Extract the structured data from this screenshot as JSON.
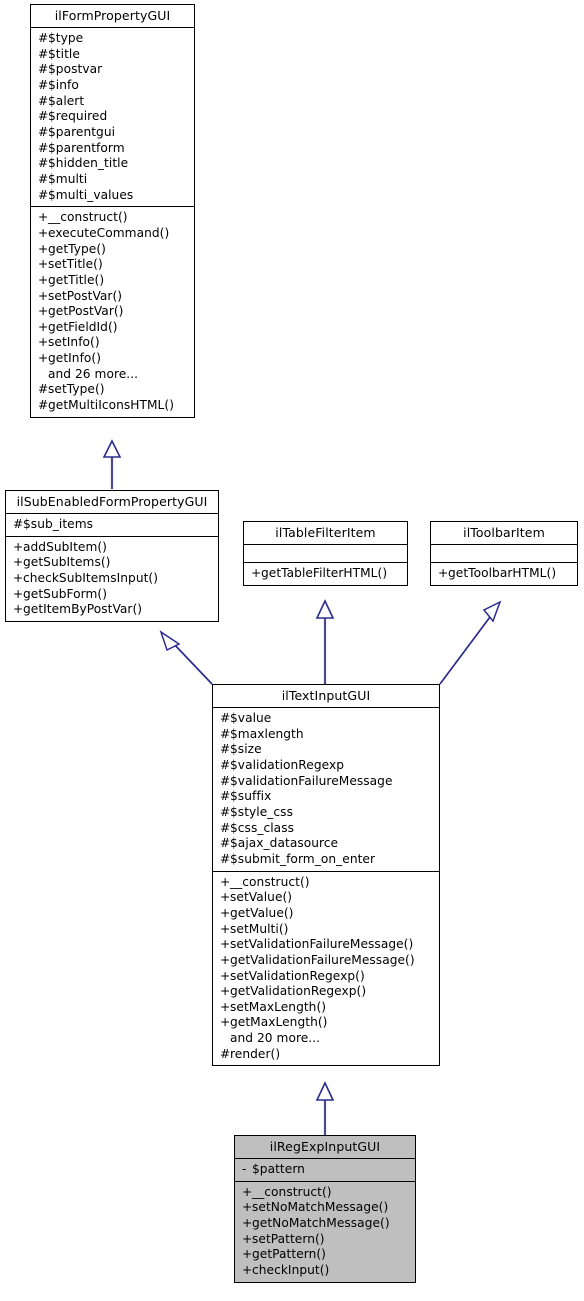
{
  "diagram": {
    "type": "uml-class-inheritance-diagram",
    "edge_color": "#2b2b8f",
    "highlight_fill": "#bfbfbf",
    "background": "#ffffff",
    "relationship": "generalization"
  },
  "classes": [
    {
      "id": "ilFormPropertyGUI",
      "name": "ilFormPropertyGUI",
      "highlighted": false,
      "attributes": [
        {
          "vis": "#",
          "label": "$type"
        },
        {
          "vis": "#",
          "label": "$title"
        },
        {
          "vis": "#",
          "label": "$postvar"
        },
        {
          "vis": "#",
          "label": "$info"
        },
        {
          "vis": "#",
          "label": "$alert"
        },
        {
          "vis": "#",
          "label": "$required"
        },
        {
          "vis": "#",
          "label": "$parentgui"
        },
        {
          "vis": "#",
          "label": "$parentform"
        },
        {
          "vis": "#",
          "label": "$hidden_title"
        },
        {
          "vis": "#",
          "label": "$multi"
        },
        {
          "vis": "#",
          "label": "$multi_values"
        }
      ],
      "operations": [
        {
          "vis": "+",
          "label": "__construct()"
        },
        {
          "vis": "+",
          "label": "executeCommand()"
        },
        {
          "vis": "+",
          "label": "getType()"
        },
        {
          "vis": "+",
          "label": "setTitle()"
        },
        {
          "vis": "+",
          "label": "getTitle()"
        },
        {
          "vis": "+",
          "label": "setPostVar()"
        },
        {
          "vis": "+",
          "label": "getPostVar()"
        },
        {
          "vis": "+",
          "label": "getFieldId()"
        },
        {
          "vis": "+",
          "label": "setInfo()"
        },
        {
          "vis": "+",
          "label": "getInfo()"
        },
        {
          "vis": "",
          "label": "and 26 more..."
        },
        {
          "vis": "#",
          "label": "setType()"
        },
        {
          "vis": "#",
          "label": "getMultiIconsHTML()"
        }
      ]
    },
    {
      "id": "ilSubEnabledFormPropertyGUI",
      "name": "ilSubEnabledFormPropertyGUI",
      "highlighted": false,
      "attributes": [
        {
          "vis": "#",
          "label": "$sub_items"
        }
      ],
      "operations": [
        {
          "vis": "+",
          "label": "addSubItem()"
        },
        {
          "vis": "+",
          "label": "getSubItems()"
        },
        {
          "vis": "+",
          "label": "checkSubItemsInput()"
        },
        {
          "vis": "+",
          "label": "getSubForm()"
        },
        {
          "vis": "+",
          "label": "getItemByPostVar()"
        }
      ]
    },
    {
      "id": "ilTableFilterItem",
      "name": "ilTableFilterItem",
      "highlighted": false,
      "attributes": [],
      "operations": [
        {
          "vis": "+",
          "label": "getTableFilterHTML()"
        }
      ]
    },
    {
      "id": "ilToolbarItem",
      "name": "ilToolbarItem",
      "highlighted": false,
      "attributes": [],
      "operations": [
        {
          "vis": "+",
          "label": "getToolbarHTML()"
        }
      ]
    },
    {
      "id": "ilTextInputGUI",
      "name": "ilTextInputGUI",
      "highlighted": false,
      "attributes": [
        {
          "vis": "#",
          "label": "$value"
        },
        {
          "vis": "#",
          "label": "$maxlength"
        },
        {
          "vis": "#",
          "label": "$size"
        },
        {
          "vis": "#",
          "label": "$validationRegexp"
        },
        {
          "vis": "#",
          "label": "$validationFailureMessage"
        },
        {
          "vis": "#",
          "label": "$suffix"
        },
        {
          "vis": "#",
          "label": "$style_css"
        },
        {
          "vis": "#",
          "label": "$css_class"
        },
        {
          "vis": "#",
          "label": "$ajax_datasource"
        },
        {
          "vis": "#",
          "label": "$submit_form_on_enter"
        }
      ],
      "operations": [
        {
          "vis": "+",
          "label": "__construct()"
        },
        {
          "vis": "+",
          "label": "setValue()"
        },
        {
          "vis": "+",
          "label": "getValue()"
        },
        {
          "vis": "+",
          "label": "setMulti()"
        },
        {
          "vis": "+",
          "label": "setValidationFailureMessage()"
        },
        {
          "vis": "+",
          "label": "getValidationFailureMessage()"
        },
        {
          "vis": "+",
          "label": "setValidationRegexp()"
        },
        {
          "vis": "+",
          "label": "getValidationRegexp()"
        },
        {
          "vis": "+",
          "label": "setMaxLength()"
        },
        {
          "vis": "+",
          "label": "getMaxLength()"
        },
        {
          "vis": "",
          "label": "and 20 more..."
        },
        {
          "vis": "#",
          "label": "render()"
        }
      ]
    },
    {
      "id": "ilRegExpInputGUI",
      "name": "ilRegExpInputGUI",
      "highlighted": true,
      "attributes": [
        {
          "vis": "-",
          "label": "$pattern"
        }
      ],
      "operations": [
        {
          "vis": "+",
          "label": "__construct()"
        },
        {
          "vis": "+",
          "label": "setNoMatchMessage()"
        },
        {
          "vis": "+",
          "label": "getNoMatchMessage()"
        },
        {
          "vis": "+",
          "label": "setPattern()"
        },
        {
          "vis": "+",
          "label": "getPattern()"
        },
        {
          "vis": "+",
          "label": "checkInput()"
        }
      ]
    }
  ],
  "edges": [
    {
      "from": "ilSubEnabledFormPropertyGUI",
      "to": "ilFormPropertyGUI"
    },
    {
      "from": "ilTextInputGUI",
      "to": "ilSubEnabledFormPropertyGUI"
    },
    {
      "from": "ilTextInputGUI",
      "to": "ilTableFilterItem"
    },
    {
      "from": "ilTextInputGUI",
      "to": "ilToolbarItem"
    },
    {
      "from": "ilRegExpInputGUI",
      "to": "ilTextInputGUI"
    }
  ]
}
